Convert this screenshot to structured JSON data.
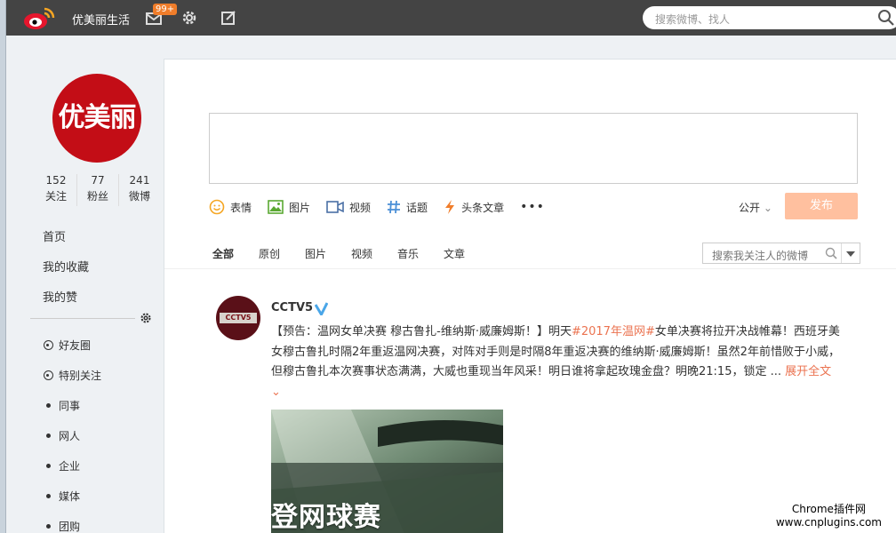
{
  "topbar": {
    "username": "优美丽生活",
    "badge": "99+",
    "search_placeholder": "搜索微博、找人"
  },
  "profile": {
    "avatar_text": "优美丽",
    "stats": [
      {
        "num": "152",
        "label": "关注"
      },
      {
        "num": "77",
        "label": "粉丝"
      },
      {
        "num": "241",
        "label": "微博"
      }
    ]
  },
  "nav": [
    "首页",
    "我的收藏",
    "我的赞"
  ],
  "groups": [
    {
      "label": "好友圈",
      "icon": "ring"
    },
    {
      "label": "特别关注",
      "icon": "ring"
    },
    {
      "label": "同事",
      "icon": "dot"
    },
    {
      "label": "网人",
      "icon": "dot"
    },
    {
      "label": "企业",
      "icon": "dot"
    },
    {
      "label": "媒体",
      "icon": "dot"
    },
    {
      "label": "团购",
      "icon": "dot"
    }
  ],
  "composer": {
    "tools": [
      "表情",
      "图片",
      "视频",
      "话题",
      "头条文章"
    ],
    "more": "•••",
    "visibility": "公开",
    "publish": "发布"
  },
  "feed_tabs": [
    "全部",
    "原创",
    "图片",
    "视频",
    "音乐",
    "文章"
  ],
  "feed_search_placeholder": "搜索我关注人的微博",
  "post": {
    "avatar_text": "CCTV5",
    "author": "CCTV5",
    "text_1": "【预告：温网女单决赛 穆古鲁扎-维纳斯·威廉姆斯！】明天",
    "hashtag": "#2017年温网#",
    "text_2": "女单决赛将拉开决战帷幕！西班牙美女穆古鲁扎时隔2年重返温网决赛，对阵对手则是时隔8年重返决赛的维纳斯·威廉姆斯！虽然2年前惜败于小威，但穆古鲁扎本次赛事状态满满，大威也重现当年风采！明日谁将拿起玫瑰金盘？明晚21:15，锁定 ... ",
    "expand": "展开全文",
    "media_caption": "登网球赛"
  },
  "watermark": {
    "line1": "Chrome插件网",
    "line2": "www.cnplugins.com"
  },
  "colors": {
    "topbar": "#444444",
    "accent": "#eb7350",
    "publish_disabled": "#ffc09f",
    "avatar_red": "#c30d16",
    "badge": "#f07d2a"
  }
}
